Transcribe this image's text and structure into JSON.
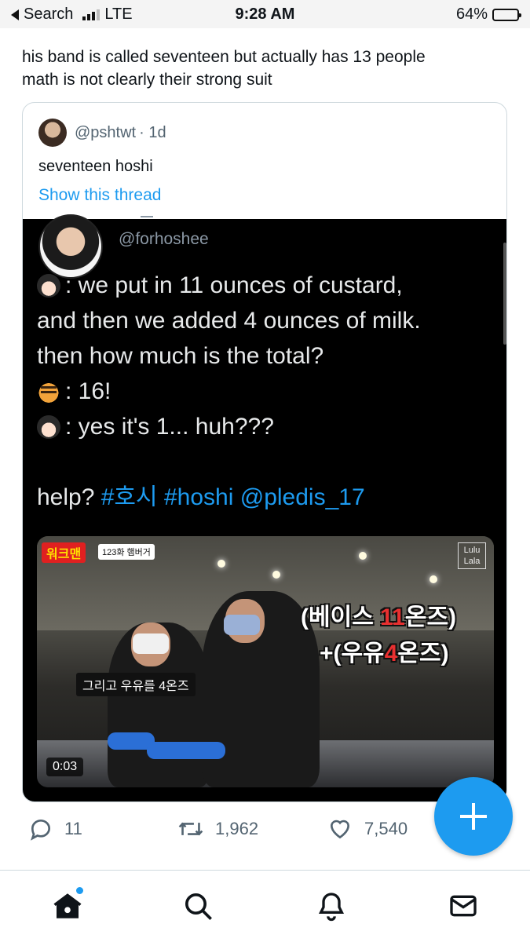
{
  "status_bar": {
    "carrier": "Search",
    "network": "LTE",
    "time": "9:28 AM",
    "battery": "64%",
    "battery_level": 0.64
  },
  "tweet": {
    "text_line1": "his band is called seventeen but actually has 13 people",
    "text_line2": "math is not clearly their strong suit"
  },
  "quoted": {
    "handle": "@pshtwt",
    "time": "· 1d",
    "text": "seventeen hoshi",
    "thread_link": "Show this thread",
    "embedded": {
      "handle": "@forhoshee",
      "line1": ": we put in 11 ounces of custard,",
      "line2": "and then we added 4 ounces of milk.",
      "line3": "then how much is the total?",
      "line4": ": 16!",
      "line5": ": yes it's 1... huh???",
      "help": "help?",
      "tag1": "#호시",
      "tag2": "#hoshi",
      "mention": "@pledis_17",
      "video": {
        "logo": "워크맨",
        "episode": "123화 햄버거",
        "brand_line1": "Lulu",
        "brand_line2": "Lala",
        "caption_open1": "(베이스 ",
        "caption_num1": "11",
        "caption_close1": "온즈)",
        "caption_open2": "+(우유",
        "caption_num2": "4",
        "caption_close2": "온즈)",
        "subtitle": "그리고 우유를 4온즈",
        "timestamp": "0:03"
      }
    }
  },
  "actions": {
    "replies": "11",
    "retweets": "1,962",
    "likes": "7,540"
  },
  "colors": {
    "accent": "#1d9bf0",
    "text": "#0f1419",
    "muted": "#536471"
  },
  "icons": [
    "back-arrow-icon",
    "signal-icon",
    "battery-icon",
    "reply-icon",
    "retweet-icon",
    "like-icon",
    "compose-icon",
    "home-icon",
    "search-icon",
    "notifications-icon",
    "messages-icon"
  ]
}
